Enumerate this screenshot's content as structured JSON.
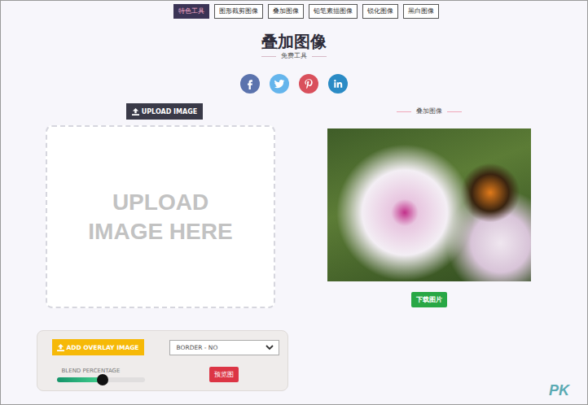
{
  "nav": {
    "items": [
      {
        "label": "特色工具",
        "selected": true
      },
      {
        "label": "图形截剪图像",
        "selected": false
      },
      {
        "label": "叠加图像",
        "selected": false
      },
      {
        "label": "铅笔素描图像",
        "selected": false
      },
      {
        "label": "锐化图像",
        "selected": false
      },
      {
        "label": "黑白图像",
        "selected": false
      }
    ]
  },
  "header": {
    "title": "叠加图像",
    "subtitle": "免费工具"
  },
  "share": [
    {
      "kind": "facebook",
      "color": "#5b73ad"
    },
    {
      "kind": "twitter",
      "color": "#65b5ec"
    },
    {
      "kind": "pinterest",
      "color": "#d9505c"
    },
    {
      "kind": "linkedin",
      "color": "#2b8bc5"
    }
  ],
  "upload": {
    "button": "UPLOAD IMAGE",
    "placeholder": "UPLOAD IMAGE HERE"
  },
  "result": {
    "label": "叠加图像",
    "download": "下载图片"
  },
  "controls": {
    "overlay_button": "ADD OVERLAY IMAGE",
    "border_select": "BORDER - NO",
    "blend_label": "BLEND PERCENTAGE",
    "blend": {
      "level": 0.52
    },
    "preview_button": "预览图"
  },
  "watermark": "PK"
}
